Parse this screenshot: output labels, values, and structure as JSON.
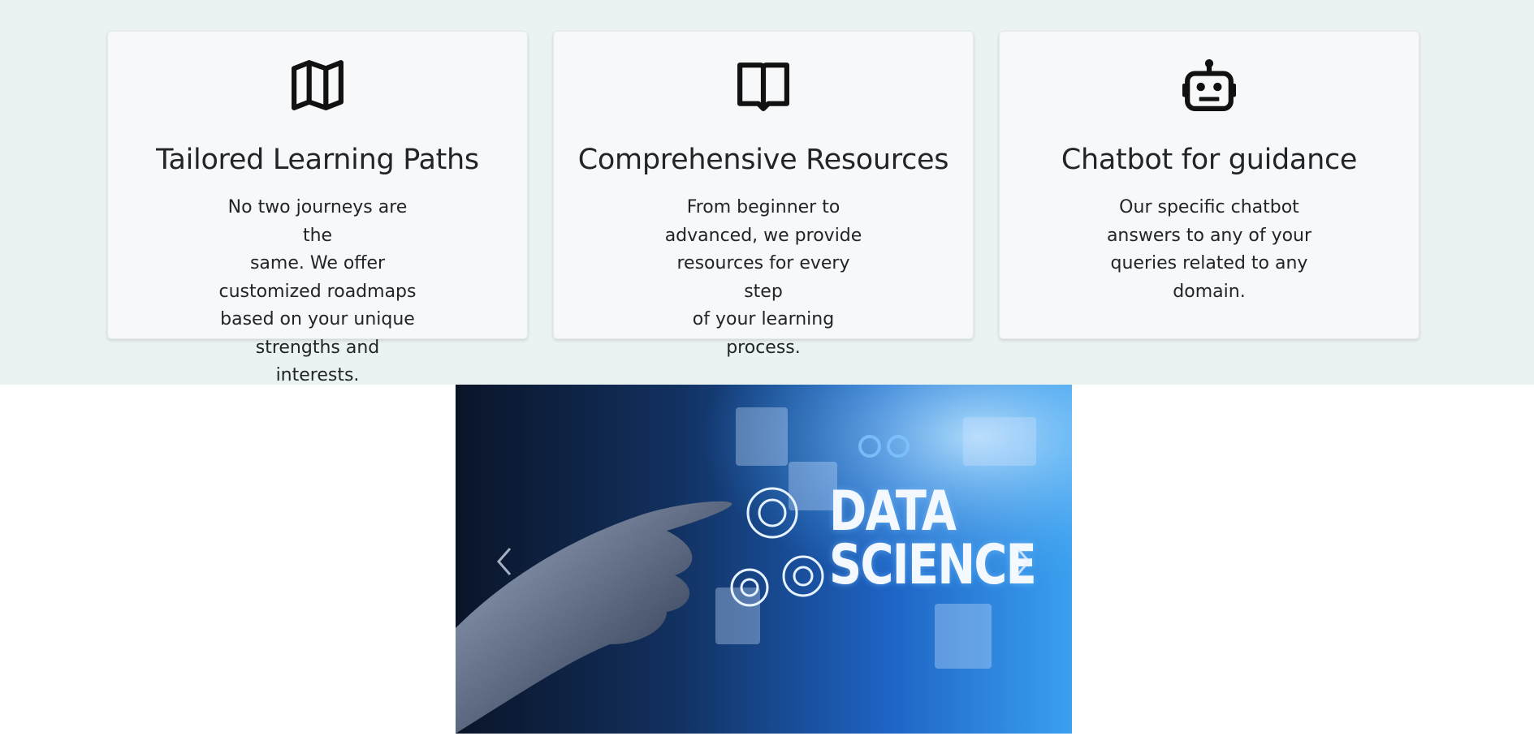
{
  "features": [
    {
      "icon": "map-icon",
      "title": "Tailored Learning Paths",
      "description_lines": [
        "No two journeys are the",
        "same. We offer",
        "customized roadmaps",
        "based on your unique",
        "strengths and interests."
      ]
    },
    {
      "icon": "book-icon",
      "title": "Comprehensive Resources",
      "description_lines": [
        "From beginner to",
        "advanced, we provide",
        "resources for every step",
        "of your learning process."
      ]
    },
    {
      "icon": "robot-icon",
      "title": "Chatbot for guidance",
      "description_lines": [
        "Our specific chatbot",
        "answers to any of your",
        "queries related to any",
        "domain."
      ]
    }
  ],
  "carousel": {
    "slide_text_line1": "DATA",
    "slide_text_line2": "SCIENCE",
    "prev_icon": "chevron-left-icon",
    "next_icon": "chevron-right-icon"
  },
  "colors": {
    "section_bg": "#ebf3f2",
    "card_bg": "#f6f8f9",
    "text": "#212529",
    "slide_blue": "#1f6fd6"
  }
}
